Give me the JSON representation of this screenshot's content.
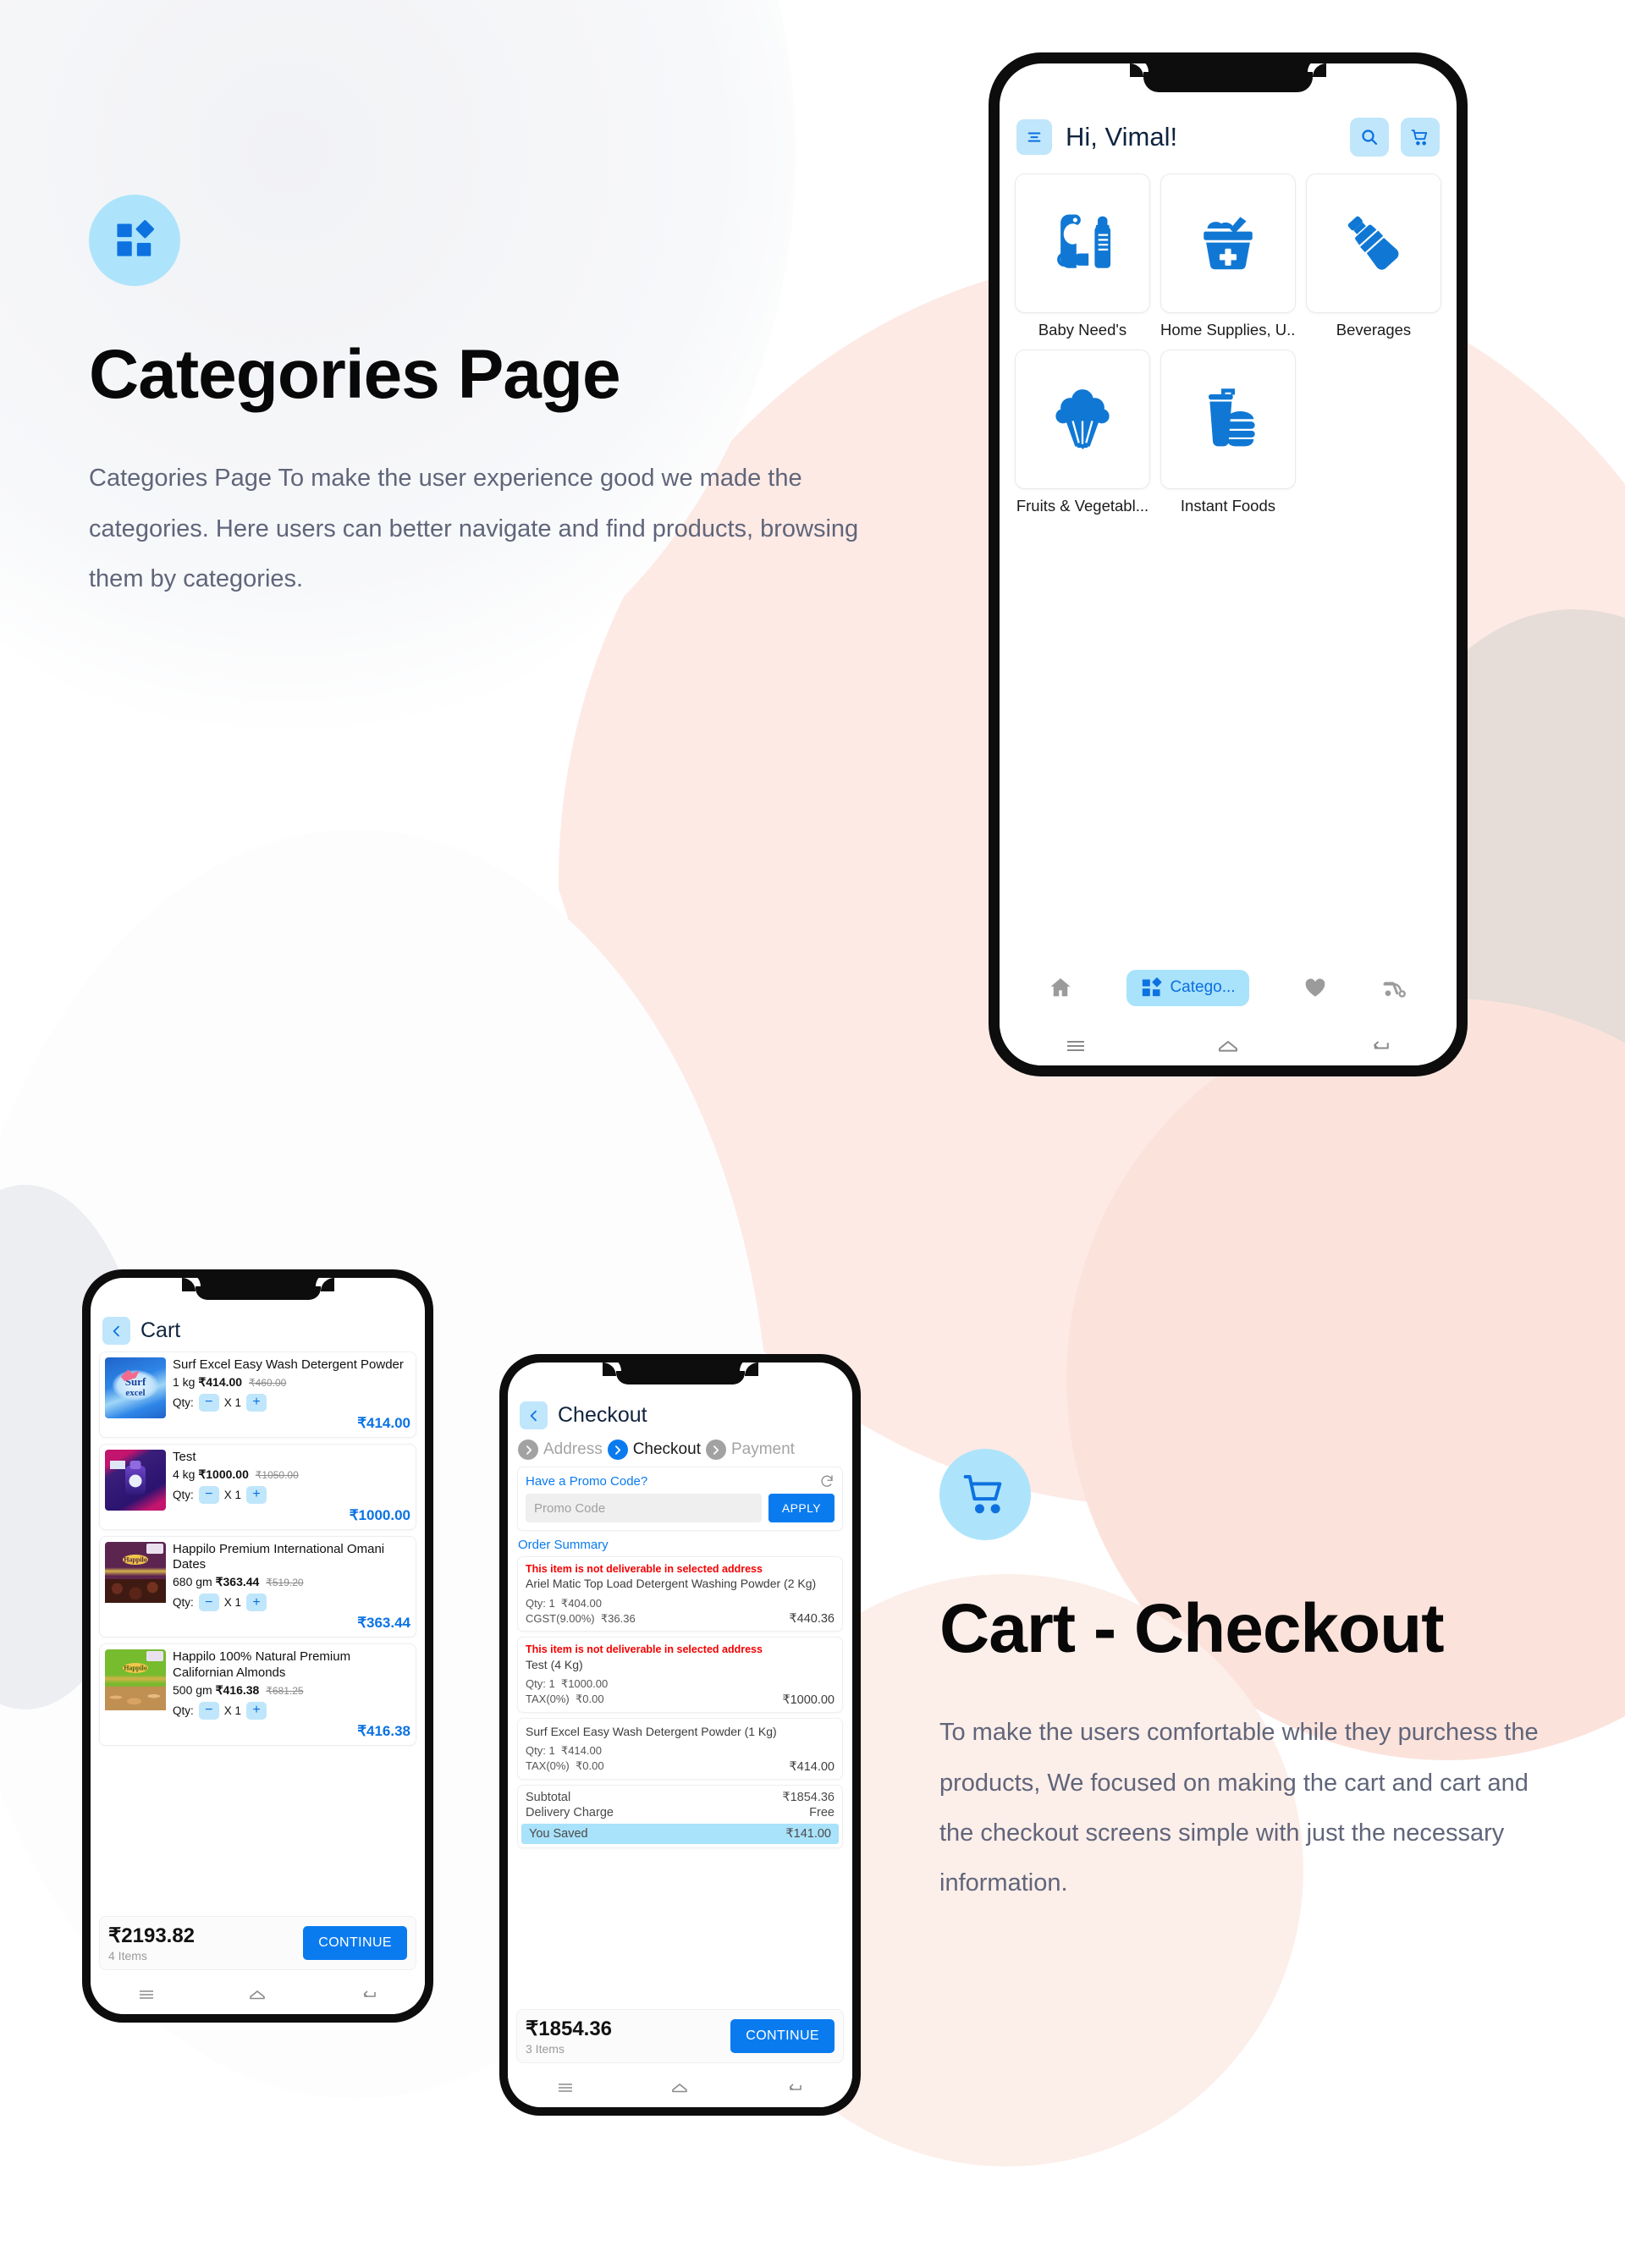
{
  "sections": {
    "categories": {
      "badge_icon": "categories-grid-icon",
      "title": "Categories Page",
      "description": "Categories Page To make the user experience good we made the categories. Here users can better navigate and find products, browsing them by categories."
    },
    "cart_checkout": {
      "badge_icon": "shopping-cart-icon",
      "title": "Cart - Checkout",
      "description": "To make the users comfortable while they purchess the products, We focused on making the cart and cart and the checkout screens simple with just the necessary information."
    }
  },
  "colors": {
    "accent_blue": "#0a7bef",
    "icon_blue": "#1078d4",
    "chip_blue": "#bfe6fb",
    "badge_blue": "#ade4fb",
    "error_red": "#f40000",
    "peach": "#fdeae5",
    "text_dark": "#10243f",
    "text_muted": "#60657a"
  },
  "phone_categories": {
    "appbar": {
      "menu_icon": "hamburger-menu-icon",
      "greeting": "Hi, Vimal!",
      "search_icon": "search-icon",
      "cart_icon": "cart-icon"
    },
    "categories": [
      {
        "label": "Baby Need's",
        "icon": "baby-bottle-icon"
      },
      {
        "label": "Home Supplies, U...",
        "icon": "cleaning-basket-icon"
      },
      {
        "label": "Beverages",
        "icon": "water-bottle-icon"
      },
      {
        "label": "Fruits & Vegetabl...",
        "icon": "broccoli-icon"
      },
      {
        "label": "Instant Foods",
        "icon": "burger-drink-icon"
      }
    ],
    "bottom_nav": [
      {
        "label": "",
        "icon": "home-icon",
        "active": false
      },
      {
        "label": "Catego...",
        "icon": "categories-grid-icon",
        "active": true
      },
      {
        "label": "",
        "icon": "heart-icon",
        "active": false
      },
      {
        "label": "",
        "icon": "scooter-delivery-icon",
        "active": false
      }
    ],
    "android_nav": [
      "menu-icon",
      "home-outline-icon",
      "back-icon"
    ]
  },
  "phone_cart": {
    "back_icon": "chevron-left-icon",
    "title": "Cart",
    "items": [
      {
        "name": "Surf Excel Easy Wash Detergent Powder",
        "weight": "1 kg",
        "price": "₹414.00",
        "strike_price": "₹460.00",
        "qty_label": "Qty:",
        "qty": "X 1",
        "minus": "−",
        "plus": "+",
        "line_total": "₹414.00",
        "img": "surf-excel-powder"
      },
      {
        "name": "Test",
        "weight": "4 kg",
        "price": "₹1000.00",
        "strike_price": "₹1050.00",
        "qty_label": "Qty:",
        "qty": "X 1",
        "minus": "−",
        "plus": "+",
        "line_total": "₹1000.00",
        "img": "surf-excel-matic"
      },
      {
        "name": "Happilo Premium International Omani Dates",
        "weight": "680 gm",
        "price": "₹363.44",
        "strike_price": "₹519.20",
        "qty_label": "Qty:",
        "qty": "X 1",
        "minus": "−",
        "plus": "+",
        "line_total": "₹363.44",
        "img": "happilo-dates"
      },
      {
        "name": "Happilo 100% Natural Premium Californian Almonds",
        "weight": "500 gm",
        "price": "₹416.38",
        "strike_price": "₹681.25",
        "qty_label": "Qty:",
        "qty": "X 1",
        "minus": "−",
        "plus": "+",
        "line_total": "₹416.38",
        "img": "happilo-almonds"
      }
    ],
    "footer": {
      "total": "₹2193.82",
      "items_count": "4 Items",
      "continue_label": "CONTINUE"
    }
  },
  "phone_checkout": {
    "back_icon": "chevron-left-icon",
    "title": "Checkout",
    "steps": [
      {
        "label": "Address",
        "active": false
      },
      {
        "label": "Checkout",
        "active": true
      },
      {
        "label": "Payment",
        "active": false
      }
    ],
    "promo": {
      "heading": "Have a Promo Code?",
      "refresh_icon": "refresh-icon",
      "placeholder": "Promo Code",
      "value": "",
      "apply_label": "APPLY"
    },
    "order_summary_title": "Order Summary",
    "summary_items": [
      {
        "warning": "This item is not deliverable in selected address",
        "name": "Ariel Matic Top Load Detergent Washing Powder (2 Kg)",
        "qty": "Qty: 1",
        "unit_price": "₹404.00",
        "tax_label": "CGST(9.00%)",
        "tax_value": "₹36.36",
        "total": "₹440.36"
      },
      {
        "warning": "This item is not deliverable in selected address",
        "name": "Test (4 Kg)",
        "qty": "Qty: 1",
        "unit_price": "₹1000.00",
        "tax_label": "TAX(0%)",
        "tax_value": "₹0.00",
        "total": "₹1000.00"
      },
      {
        "warning": "",
        "name": "Surf Excel Easy Wash Detergent Powder (1 Kg)",
        "qty": "Qty: 1",
        "unit_price": "₹414.00",
        "tax_label": "TAX(0%)",
        "tax_value": "₹0.00",
        "total": "₹414.00"
      }
    ],
    "totals": {
      "subtotal_label": "Subtotal",
      "subtotal_value": "₹1854.36",
      "delivery_label": "Delivery Charge",
      "delivery_value": "Free",
      "saved_label": "You Saved",
      "saved_value": "₹141.00"
    },
    "footer": {
      "total": "₹1854.36",
      "items_count": "3 Items",
      "continue_label": "CONTINUE"
    }
  }
}
